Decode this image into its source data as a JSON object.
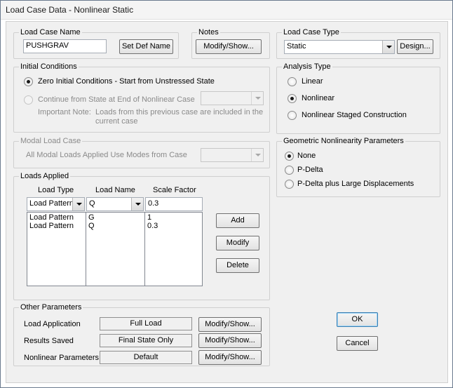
{
  "window": {
    "title": "Load Case Data - Nonlinear Static"
  },
  "load_case_name": {
    "legend": "Load Case Name",
    "value": "PUSHGRAV",
    "set_def_name": "Set Def Name"
  },
  "notes": {
    "legend": "Notes",
    "modify_show": "Modify/Show..."
  },
  "load_case_type": {
    "legend": "Load Case Type",
    "value": "Static",
    "design": "Design..."
  },
  "initial_conditions": {
    "legend": "Initial Conditions",
    "option_zero": "Zero Initial Conditions - Start from Unstressed State",
    "option_continue": "Continue from State at End of Nonlinear Case",
    "note_label": "Important Note:",
    "note_line1": "Loads from this previous case are included in the",
    "note_line2": "current case",
    "selected": "zero"
  },
  "analysis_type": {
    "legend": "Analysis Type",
    "options": [
      "Linear",
      "Nonlinear",
      "Nonlinear Staged Construction"
    ],
    "selected": "Nonlinear"
  },
  "modal_load_case": {
    "legend": "Modal Load Case",
    "label": "All Modal Loads Applied Use Modes from Case"
  },
  "geometric_nonlinearity": {
    "legend": "Geometric Nonlinearity Parameters",
    "options": [
      "None",
      "P-Delta",
      "P-Delta plus Large Displacements"
    ],
    "selected": "None"
  },
  "loads_applied": {
    "legend": "Loads Applied",
    "columns": [
      "Load Type",
      "Load Name",
      "Scale Factor"
    ],
    "entry": {
      "load_type": "Load Pattern",
      "load_name": "Q",
      "scale_factor": "0.3"
    },
    "rows": [
      {
        "load_type": "Load Pattern",
        "load_name": "G",
        "scale_factor": "1"
      },
      {
        "load_type": "Load Pattern",
        "load_name": "Q",
        "scale_factor": "0.3"
      }
    ],
    "add": "Add",
    "modify": "Modify",
    "delete": "Delete"
  },
  "other_parameters": {
    "legend": "Other Parameters",
    "load_application_label": "Load Application",
    "load_application_value": "Full Load",
    "results_saved_label": "Results Saved",
    "results_saved_value": "Final State Only",
    "nonlinear_parameters_label": "Nonlinear Parameters",
    "nonlinear_parameters_value": "Default",
    "modify_show": "Modify/Show..."
  },
  "dialog": {
    "ok": "OK",
    "cancel": "Cancel"
  }
}
